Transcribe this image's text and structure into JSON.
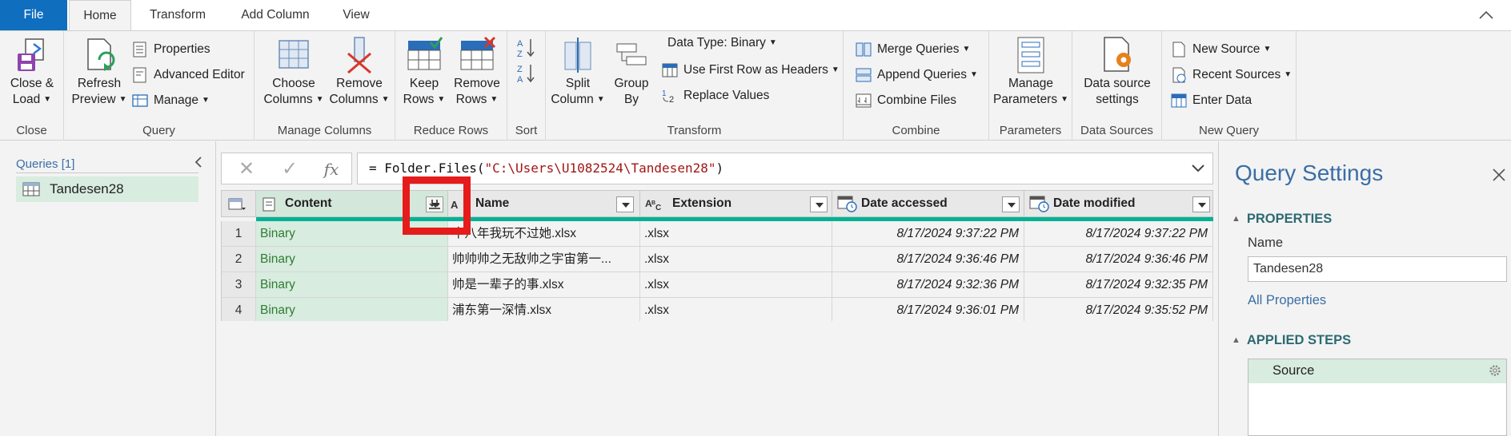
{
  "menu": {
    "tabs": [
      "File",
      "Home",
      "Transform",
      "Add Column",
      "View"
    ],
    "active": "Home"
  },
  "ribbon": {
    "close": {
      "label": "Close &\nLoad",
      "label1": "Close &",
      "label2": "Load",
      "group": "Close"
    },
    "query": {
      "refresh1": "Refresh",
      "refresh2": "Preview",
      "properties": "Properties",
      "advanced_editor": "Advanced Editor",
      "manage": "Manage",
      "group": "Query"
    },
    "manage_columns": {
      "choose1": "Choose",
      "choose2": "Columns",
      "remove1": "Remove",
      "remove2": "Columns",
      "group": "Manage Columns"
    },
    "reduce_rows": {
      "keep1": "Keep",
      "keep2": "Rows",
      "remove1": "Remove",
      "remove2": "Rows",
      "group": "Reduce Rows"
    },
    "sort": {
      "group": "Sort"
    },
    "transform": {
      "split1": "Split",
      "split2": "Column",
      "group1": "Group",
      "group2": "By",
      "data_type": "Data Type: Binary",
      "first_row": "Use First Row as Headers",
      "replace": "Replace Values",
      "group": "Transform"
    },
    "combine": {
      "merge": "Merge Queries",
      "append": "Append Queries",
      "combine_files": "Combine Files",
      "group": "Combine"
    },
    "parameters": {
      "manage1": "Manage",
      "manage2": "Parameters",
      "group": "Parameters"
    },
    "data_sources": {
      "ds1": "Data source",
      "ds2": "settings",
      "group": "Data Sources"
    },
    "new_query": {
      "new_source": "New Source",
      "recent_sources": "Recent Sources",
      "enter_data": "Enter Data",
      "group": "New Query"
    }
  },
  "queries_pane": {
    "title": "Queries [1]",
    "items": [
      {
        "label": "Tandesen28"
      }
    ]
  },
  "formula_bar": {
    "prefix": "= Folder.Files(",
    "string": "\"C:\\Users\\U1082524\\Tandesen28\"",
    "suffix": ")"
  },
  "table": {
    "columns": [
      {
        "label": "Content"
      },
      {
        "label": "Name"
      },
      {
        "label": "Extension"
      },
      {
        "label": "Date accessed"
      },
      {
        "label": "Date modified"
      }
    ],
    "rows": [
      {
        "n": "1",
        "content": "Binary",
        "name": "十八年我玩不过她.xlsx",
        "ext": ".xlsx",
        "accessed": "8/17/2024 9:37:22 PM",
        "modified": "8/17/2024 9:37:22 PM"
      },
      {
        "n": "2",
        "content": "Binary",
        "name": "帅帅帅之无敌帅之宇宙第一...",
        "ext": ".xlsx",
        "accessed": "8/17/2024 9:36:46 PM",
        "modified": "8/17/2024 9:36:46 PM"
      },
      {
        "n": "3",
        "content": "Binary",
        "name": "帅是一辈子的事.xlsx",
        "ext": ".xlsx",
        "accessed": "8/17/2024 9:32:36 PM",
        "modified": "8/17/2024 9:32:35 PM"
      },
      {
        "n": "4",
        "content": "Binary",
        "name": "浦东第一深情.xlsx",
        "ext": ".xlsx",
        "accessed": "8/17/2024 9:36:01 PM",
        "modified": "8/17/2024 9:35:52 PM"
      }
    ]
  },
  "settings": {
    "title": "Query Settings",
    "properties_heading": "PROPERTIES",
    "name_label": "Name",
    "name_value": "Tandesen28",
    "all_properties": "All Properties",
    "steps_heading": "APPLIED STEPS",
    "steps": [
      {
        "label": "Source"
      }
    ]
  },
  "colors": {
    "file_tab": "#106ebe",
    "highlight": "#e61b1b",
    "binary_text": "#2e7d32",
    "selected_bg": "#d8ecdf",
    "quality_bar": "#00b294",
    "heading_blue": "#3a6ea5"
  }
}
